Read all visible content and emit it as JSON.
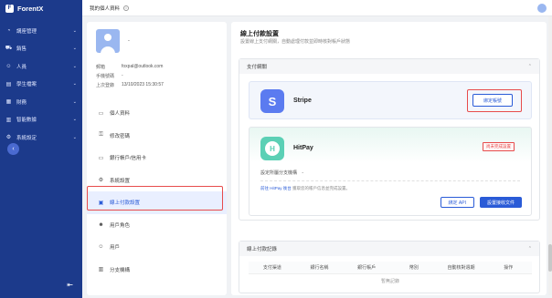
{
  "app": {
    "brand": "ForentX"
  },
  "sidebar": {
    "items": [
      {
        "label": "講座管理",
        "icon": "gauge-icon"
      },
      {
        "label": "銷售",
        "icon": "cart-icon"
      },
      {
        "label": "人員",
        "icon": "user-icon"
      },
      {
        "label": "學生檔案",
        "icon": "file-icon"
      },
      {
        "label": "財務",
        "icon": "ledger-icon"
      },
      {
        "label": "智能數據",
        "icon": "chart-icon"
      },
      {
        "label": "系統設定",
        "icon": "gear-icon"
      }
    ],
    "logout_icon": "logout-icon"
  },
  "topbar": {
    "title": "我的個人資料"
  },
  "profile": {
    "name": "-",
    "info": [
      {
        "key": "郵箱",
        "value": "foxpal@outlook.com"
      },
      {
        "key": "手機號碼",
        "value": "-"
      },
      {
        "key": "上次登錄",
        "value": "13/10/2023 15:30:57"
      }
    ],
    "menu": [
      {
        "label": "個人資料",
        "icon": "id-card-icon",
        "active": false
      },
      {
        "label": "修改密碼",
        "icon": "lock-icon",
        "active": false
      },
      {
        "label": "銀行帳戶/信用卡",
        "icon": "card-icon",
        "active": false
      },
      {
        "label": "系統設置",
        "icon": "gear-icon",
        "active": false
      },
      {
        "label": "線上付款設置",
        "icon": "wallet-icon",
        "active": true
      },
      {
        "label": "用戶角色",
        "icon": "users-icon",
        "active": false
      },
      {
        "label": "用戶",
        "icon": "user-icon",
        "active": false
      },
      {
        "label": "分支機構",
        "icon": "branch-icon",
        "active": false
      }
    ]
  },
  "main": {
    "title": "線上付款設置",
    "subtitle": "設置線上支付網關，自動處理付款並即時核對帳戶狀態",
    "gateways_section": {
      "title": "支付網關"
    },
    "stripe": {
      "name": "Stripe",
      "logo_letter": "S",
      "button": "綁定帳號"
    },
    "hitpay": {
      "name": "HitPay",
      "logo_letter": "H",
      "badge": "尚未完成設置",
      "field_label": "設定所屬分支機構",
      "field_value": "-",
      "note_link": "前往 HitPay 後台",
      "note_text": "獲取您的帳戶信息並完成設置。",
      "buttons": [
        "綁定 API",
        "設置接收文件"
      ]
    },
    "records_section": {
      "title": "線上付款記錄",
      "columns": [
        "支付渠道",
        "銀行名稱",
        "銀行帳戶",
        "幣別",
        "自動核對週期",
        "操作"
      ],
      "empty": "暫無記錄"
    }
  },
  "colors": {
    "sidebar": "#1c3a8b",
    "accent": "#2a5bd7",
    "highlight": "#e74c4c"
  }
}
